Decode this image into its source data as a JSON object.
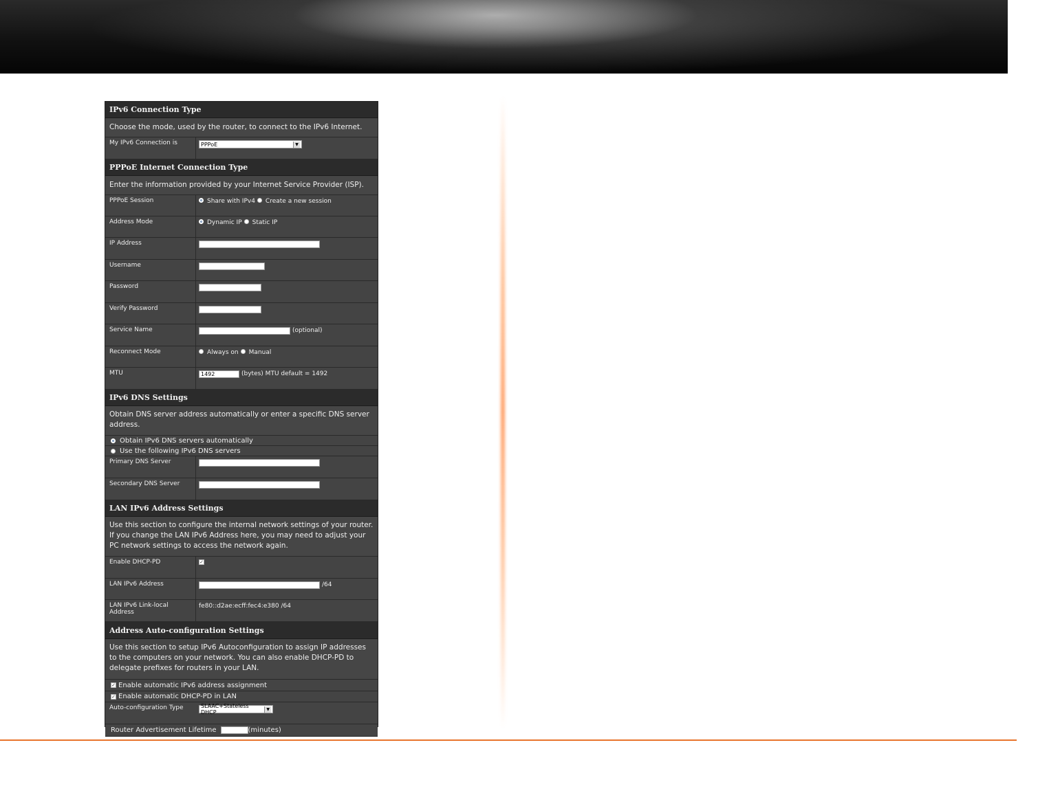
{
  "ipv6_conn": {
    "header": "IPv6 Connection Type",
    "desc": "Choose the mode, used by the router, to connect to the IPv6 Internet.",
    "label": "My IPv6 Connection is",
    "selected": "PPPoE"
  },
  "pppoe": {
    "header": "PPPoE Internet Connection Type",
    "desc": "Enter the information provided by your Internet Service Provider (ISP).",
    "session_label": "PPPoE Session",
    "session_opt1": "Share with IPv4",
    "session_opt2": "Create a new session",
    "addr_mode_label": "Address Mode",
    "addr_opt1": "Dynamic IP",
    "addr_opt2": "Static IP",
    "ip_label": "IP Address",
    "user_label": "Username",
    "pass_label": "Password",
    "verify_label": "Verify Password",
    "service_label": "Service Name",
    "service_hint": "(optional)",
    "reconnect_label": "Reconnect Mode",
    "reconnect_opt1": "Always on",
    "reconnect_opt2": "Manual",
    "mtu_label": "MTU",
    "mtu_value": "1492",
    "mtu_hint": "(bytes) MTU default = 1492"
  },
  "dns": {
    "header": "IPv6 DNS Settings",
    "desc": "Obtain DNS server address automatically or enter a specific DNS server address.",
    "opt_auto": "Obtain IPv6 DNS servers automatically",
    "opt_manual": "Use the following IPv6 DNS servers",
    "primary_label": "Primary DNS Server",
    "secondary_label": "Secondary DNS Server"
  },
  "lan": {
    "header": "LAN IPv6 Address Settings",
    "desc": "Use this section to configure the internal network settings of your router. If you change the LAN IPv6 Address here, you may need to adjust your PC network settings to access the network again.",
    "dhcp_pd_label": "Enable DHCP-PD",
    "addr_label": "LAN IPv6 Address",
    "addr_suffix": "/64",
    "link_local_label": "LAN IPv6 Link-local Address",
    "link_local_value": "fe80::d2ae:ecff:fec4:e380 /64"
  },
  "autoconf": {
    "header": "Address Auto-configuration Settings",
    "desc": "Use this section to setup IPv6 Autoconfiguration to assign IP addresses to the computers on your network. You can also enable DHCP-PD to delegate prefixes for routers in your LAN.",
    "chk_auto_assign": "Enable automatic IPv6 address assignment",
    "chk_dhcp_pd": "Enable automatic DHCP-PD in LAN",
    "type_label": "Auto-configuration Type",
    "type_value": "SLAAC+Stateless DHCP",
    "ra_label": "Router Advertisement Lifetime",
    "ra_unit": "(minutes)"
  }
}
